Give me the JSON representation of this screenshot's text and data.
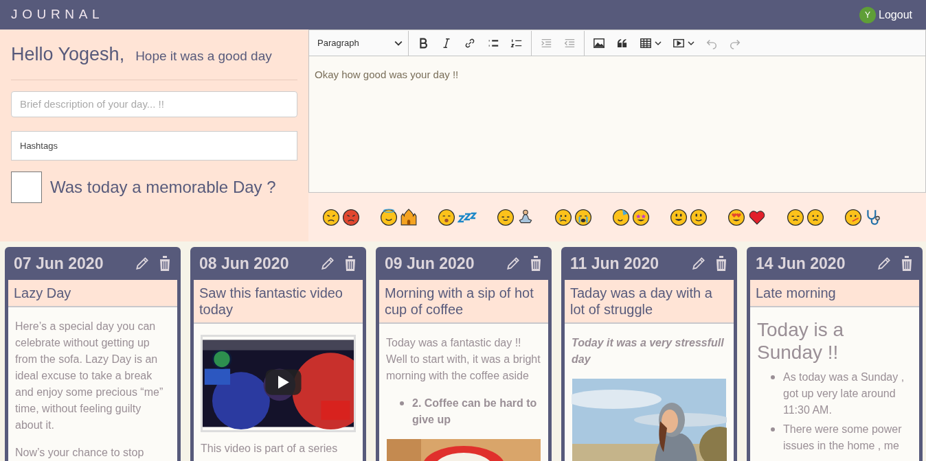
{
  "header": {
    "brand": "JOURNAL",
    "user_initial": "Y",
    "logout": "Logout"
  },
  "greeting": {
    "hello": "Hello Yogesh,",
    "subtitle": "Hope it was a good day"
  },
  "form": {
    "description": {
      "placeholder": "Brief description of your day... !!"
    },
    "hashtags": {
      "placeholder": "Hashtags"
    },
    "memorable": {
      "label": "Was today a memorable Day ?",
      "checked": false
    }
  },
  "editor": {
    "block_format": "Paragraph",
    "placeholder": "Okay how good was your day !!"
  },
  "cards": [
    {
      "date": "07 Jun 2020",
      "title": "Lazy Day",
      "body": [
        {
          "kind": "paragraph",
          "text": "Here’s a special day you can celebrate without getting up from the sofa. Lazy Day is an ideal excuse to take a break and enjoy some precious “me” time, without feeling guilty about it."
        },
        {
          "kind": "paragraph",
          "text": "Now’s your chance to stop"
        }
      ]
    },
    {
      "date": "08 Jun 2020",
      "title": "Saw this fantastic video today",
      "body": [
        {
          "kind": "video"
        },
        {
          "kind": "paragraph",
          "text": "This video is part of a series"
        }
      ]
    },
    {
      "date": "09 Jun 2020",
      "title": "Morning with a sip of hot cup of coffee",
      "body": [
        {
          "kind": "paragraph",
          "text": "Today was a fantastic day !! Well to start with, it was a bright morning with the coffee aside"
        },
        {
          "kind": "bullets",
          "bold": true,
          "items": [
            "2. Coffee can be hard to give up"
          ]
        },
        {
          "kind": "coffee_picture"
        }
      ]
    },
    {
      "date": "11 Jun 2020",
      "title": "Taday was a day with a lot of struggle",
      "body": [
        {
          "kind": "emphasis",
          "text": "Today it was a very stressfull day"
        },
        {
          "kind": "person_picture"
        }
      ]
    },
    {
      "date": "14 Jun 2020",
      "title": "Late morning",
      "body": [
        {
          "kind": "heading",
          "text": "Today is a Sunday !!"
        },
        {
          "kind": "bullets",
          "bold": false,
          "items": [
            "As today was a Sunday , got up very late around 11:30 AM.",
            "There were some power issues in the home , me"
          ]
        }
      ]
    }
  ]
}
